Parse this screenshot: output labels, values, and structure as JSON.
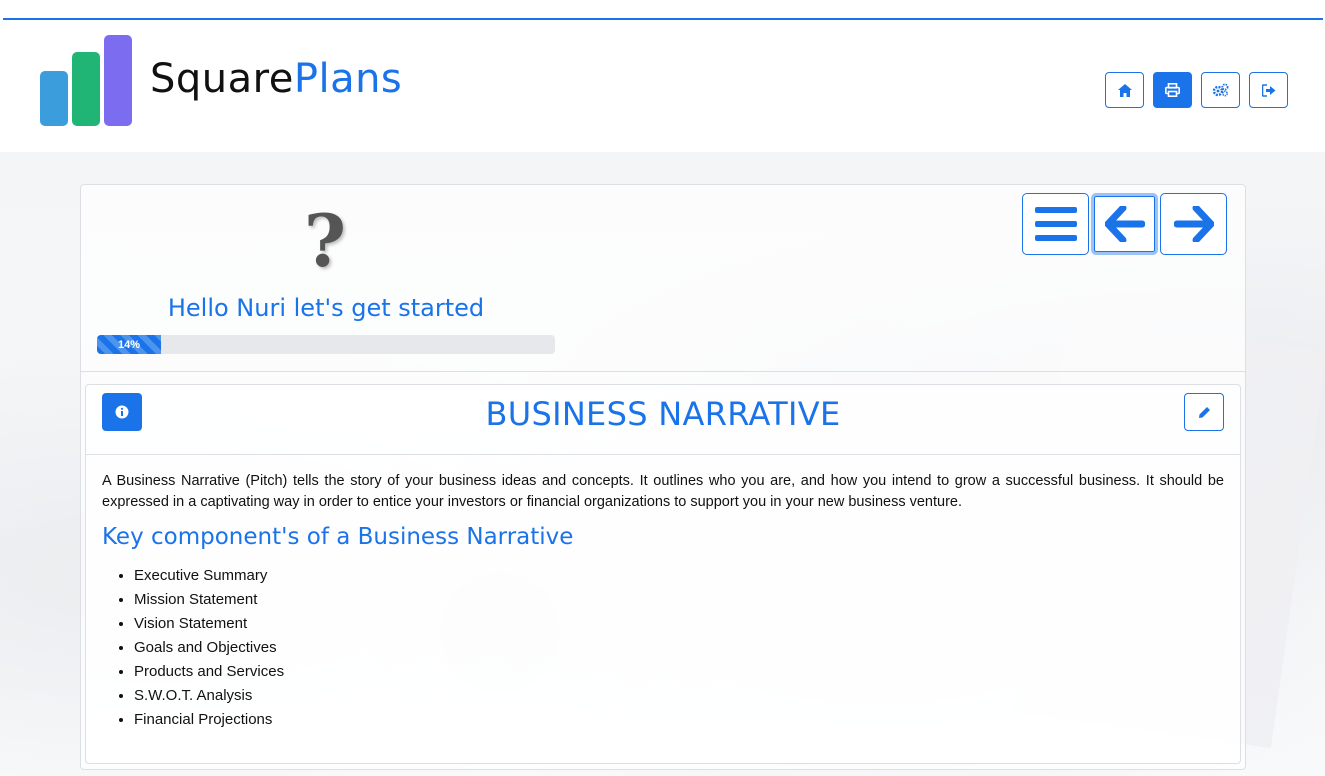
{
  "brand": {
    "word1": "Square",
    "word2": "Plans"
  },
  "header_buttons": [
    {
      "name": "home",
      "icon": "home-icon"
    },
    {
      "name": "print",
      "icon": "print-icon"
    },
    {
      "name": "settings",
      "icon": "gears-icon"
    },
    {
      "name": "logout",
      "icon": "sign-out-icon"
    }
  ],
  "colors": {
    "accent": "#1a73e8",
    "logo_blue": "#3b9ddb",
    "logo_green": "#20b575",
    "logo_purple": "#7b6cf0"
  },
  "intro": {
    "icon": "question-mark-icon",
    "greeting": "Hello Nuri let's get started",
    "progress_label": "14%",
    "progress_value": 0.14
  },
  "navigation": [
    {
      "name": "menu",
      "icon": "bars-icon"
    },
    {
      "name": "previous",
      "icon": "arrow-left-icon"
    },
    {
      "name": "next",
      "icon": "arrow-right-icon"
    }
  ],
  "section": {
    "title": "BUSINESS NARRATIVE",
    "info_icon": "info-icon",
    "edit_icon": "pencil-icon",
    "description": "A Business Narrative (Pitch) tells the story of your business ideas and concepts. It outlines who you are, and how you intend to grow a successful business. It should be expressed in a captivating way in order to entice your investors or financial organizations to support you in your new business venture.",
    "subheading": "Key component's of a Business Narrative",
    "components": [
      "Executive Summary",
      "Mission Statement",
      "Vision Statement",
      "Goals and Objectives",
      "Products and Services",
      "S.W.O.T. Analysis",
      "Financial Projections"
    ]
  }
}
